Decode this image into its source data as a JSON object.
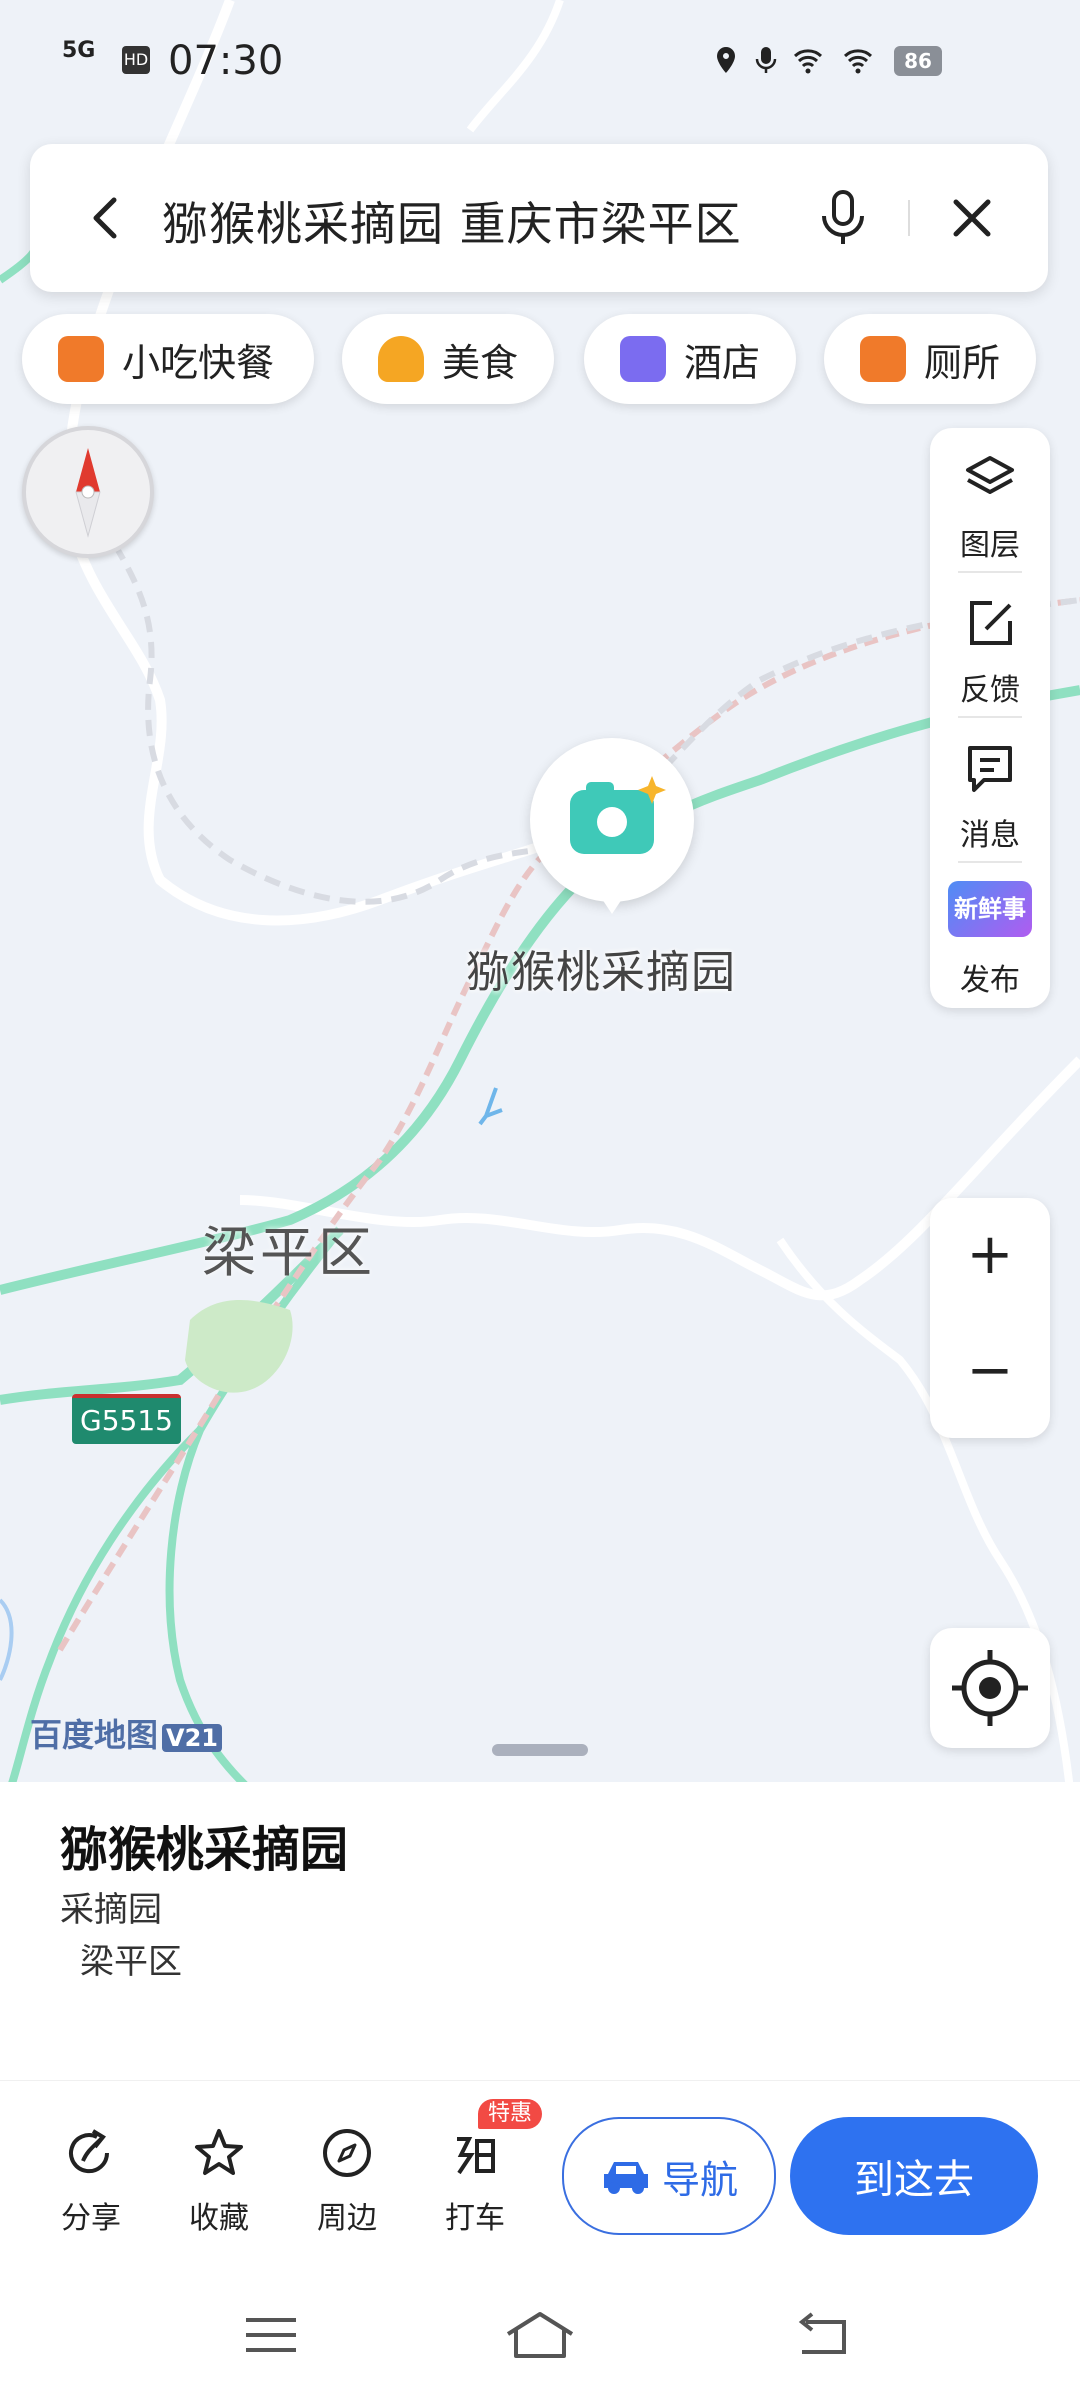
{
  "status_bar": {
    "network": "5G",
    "hd": "HD",
    "time": "07:30",
    "battery": "86"
  },
  "search": {
    "query": "猕猴桃采摘园 重庆市梁平区"
  },
  "chips": [
    {
      "label": "小吃快餐",
      "icon": "burger-icon",
      "color": "#f07a2a"
    },
    {
      "label": "美食",
      "icon": "food-icon",
      "color": "#f5a623"
    },
    {
      "label": "酒店",
      "icon": "hotel-icon",
      "color": "#7b6cf0"
    },
    {
      "label": "厕所",
      "icon": "toilet-icon",
      "color": "#f07a2a"
    }
  ],
  "tools": [
    {
      "label": "图层",
      "icon": "layers-icon"
    },
    {
      "label": "反馈",
      "icon": "feedback-icon"
    },
    {
      "label": "消息",
      "icon": "message-icon"
    },
    {
      "label": "发布",
      "icon": "publish-icon",
      "badge_text": "新鲜事"
    }
  ],
  "map": {
    "pin_label": "猕猴桃采摘园",
    "district_label": "梁平区",
    "highway_shield": "G5515",
    "watermark": "百度地图",
    "watermark_version": "V21",
    "colors": {
      "road": "#7fd9b7",
      "railway": "#e8b8b8",
      "park": "#cdeac8",
      "background": "#eef2f8"
    }
  },
  "zoom": {
    "in": "+",
    "out": "−"
  },
  "place": {
    "title": "猕猴桃采摘园",
    "category": "采摘园",
    "district": "梁平区"
  },
  "actions": [
    {
      "label": "分享",
      "icon": "share-icon"
    },
    {
      "label": "收藏",
      "icon": "star-icon"
    },
    {
      "label": "周边",
      "icon": "compass-icon"
    },
    {
      "label": "打车",
      "icon": "taxi-icon",
      "badge": "特惠"
    }
  ],
  "buttons": {
    "navigate": "导航",
    "go_here": "到这去",
    "accent": "#2e72f0"
  }
}
